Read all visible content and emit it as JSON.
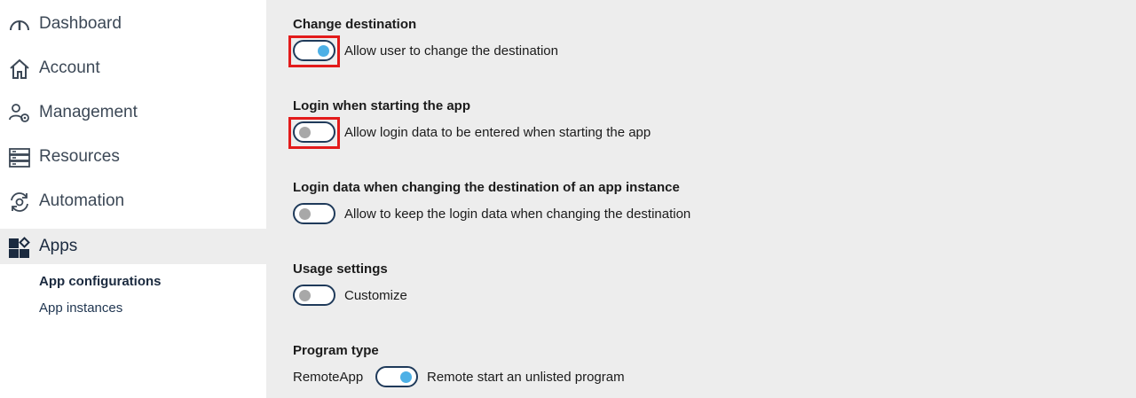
{
  "sidebar": {
    "items": [
      {
        "label": "Dashboard",
        "icon": "gauge-icon"
      },
      {
        "label": "Account",
        "icon": "home-icon"
      },
      {
        "label": "Management",
        "icon": "users-gear-icon"
      },
      {
        "label": "Resources",
        "icon": "server-icon"
      },
      {
        "label": "Automation",
        "icon": "cycle-gear-icon"
      },
      {
        "label": "Apps",
        "icon": "apps-grid-icon",
        "active": true
      }
    ],
    "sub_items": [
      {
        "label": "App configurations",
        "active": true
      },
      {
        "label": "App instances"
      }
    ]
  },
  "settings": {
    "change_destination": {
      "title": "Change destination",
      "label": "Allow user to change the destination",
      "state": "on"
    },
    "login_start": {
      "title": "Login when starting the app",
      "label": "Allow login data to be entered when starting the app",
      "state": "off"
    },
    "login_change": {
      "title": "Login data when changing the destination of an app instance",
      "label": "Allow to keep the login data when changing the destination",
      "state": "off"
    },
    "usage": {
      "title": "Usage settings",
      "label": "Customize",
      "state": "off"
    },
    "program_type": {
      "title": "Program type",
      "left_label": "RemoteApp",
      "label": "Remote start an unlisted program",
      "state": "on"
    }
  },
  "colors": {
    "accent": "#4db0e6",
    "toggle_border": "#1f3a5a",
    "highlight": "#e31b1b",
    "panel_bg": "#ededed"
  }
}
